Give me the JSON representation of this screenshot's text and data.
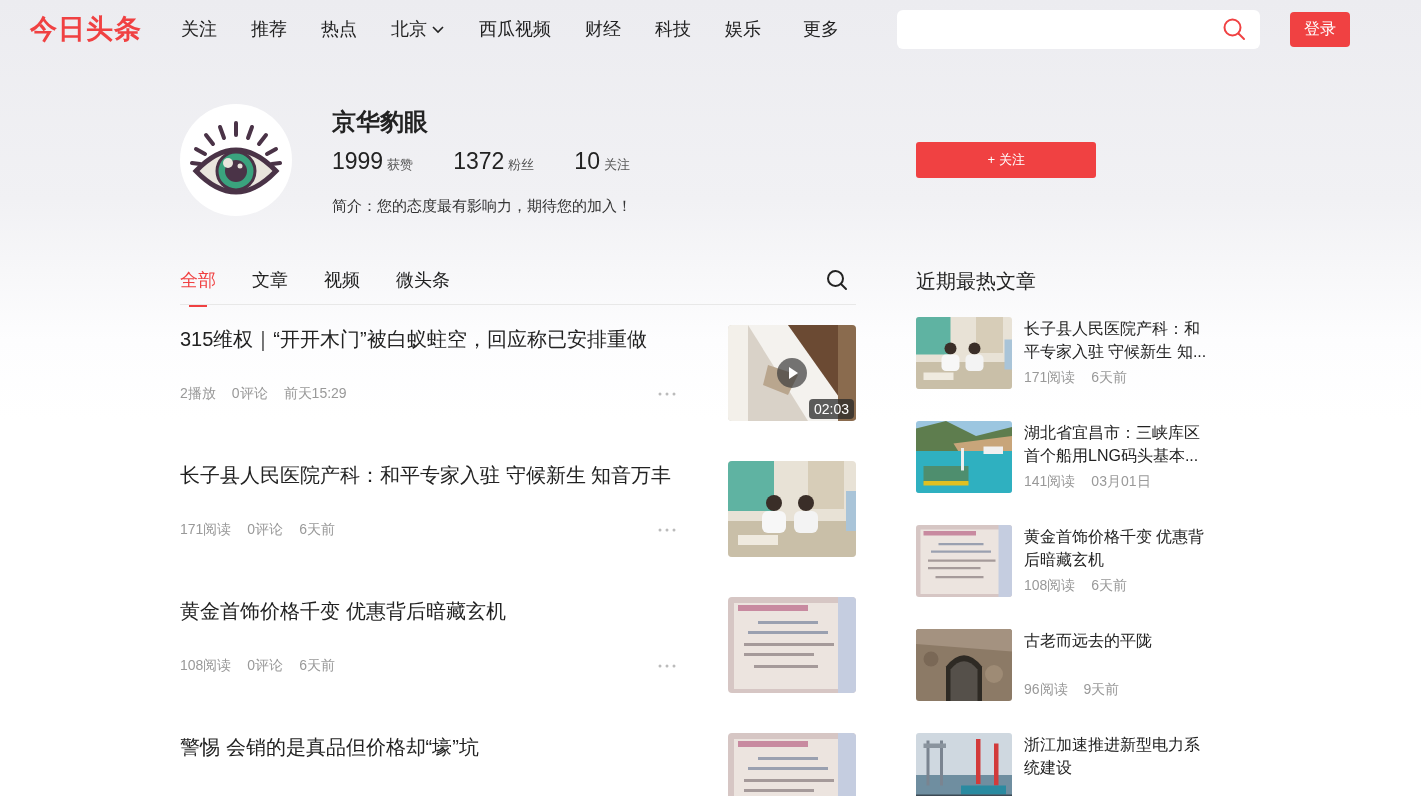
{
  "header": {
    "logo": "今日头条",
    "nav": [
      {
        "label": "关注",
        "kind": "link"
      },
      {
        "label": "推荐",
        "kind": "link"
      },
      {
        "label": "热点",
        "kind": "link"
      },
      {
        "label": "北京",
        "kind": "dropdown"
      },
      {
        "label": "西瓜视频",
        "kind": "link"
      },
      {
        "label": "财经",
        "kind": "link"
      },
      {
        "label": "科技",
        "kind": "link"
      },
      {
        "label": "娱乐",
        "kind": "link"
      },
      {
        "label": "更多",
        "kind": "link"
      }
    ],
    "login": "登录"
  },
  "profile": {
    "name": "京华豹眼",
    "stats": [
      {
        "value": "1999",
        "label": "获赞"
      },
      {
        "value": "1372",
        "label": "粉丝"
      },
      {
        "value": "10",
        "label": "关注"
      }
    ],
    "bio": "简介：您的态度最有影响力，期待您的加入！",
    "follow": "+ 关注"
  },
  "tabs": [
    {
      "label": "全部",
      "selected": true
    },
    {
      "label": "文章",
      "selected": false
    },
    {
      "label": "视频",
      "selected": false
    },
    {
      "label": "微头条",
      "selected": false
    }
  ],
  "feed": [
    {
      "title": "315维权｜“开开木门”被白蚁蛀空，回应称已安排重做",
      "meta": [
        "2播放",
        "0评论",
        "前天15:29"
      ],
      "duration": "02:03"
    },
    {
      "title": "长子县人民医院产科：和平专家入驻 守候新生 知音万丰",
      "meta": [
        "171阅读",
        "0评论",
        "6天前"
      ]
    },
    {
      "title": "黄金首饰价格千变 优惠背后暗藏玄机",
      "meta": [
        "108阅读",
        "0评论",
        "6天前"
      ]
    },
    {
      "title": "警惕 会销的是真品但价格却“壕”坑"
    }
  ],
  "hot": {
    "title": "近期最热文章",
    "items": [
      {
        "title": "长子县人民医院产科：和平专家入驻 守候新生 知...",
        "reads": "171阅读",
        "time": "6天前"
      },
      {
        "title": "湖北省宜昌市：三峡库区首个船用LNG码头基本...",
        "reads": "141阅读",
        "time": "03月01日"
      },
      {
        "title": "黄金首饰价格千变 优惠背后暗藏玄机",
        "reads": "108阅读",
        "time": "6天前"
      },
      {
        "title": "古老而远去的平陇",
        "reads": "96阅读",
        "time": "9天前"
      },
      {
        "title": "浙江加速推进新型电力系统建设"
      }
    ]
  }
}
